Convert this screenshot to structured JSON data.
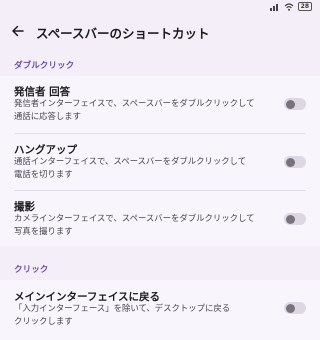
{
  "status": {
    "battery": "28"
  },
  "app_bar": {
    "title": "スペースバーのショートカット"
  },
  "sections": [
    {
      "header": "ダブルクリック",
      "items": [
        {
          "title": "発信者 回答",
          "desc_line1": "発信者インターフェイスで、スペースバーをダブルクリックして",
          "desc_line2": "通話に応答します",
          "enabled": false
        },
        {
          "title": "ハングアップ",
          "desc_line1": "通話インターフェイスで、スペースバーをダブルクリックして",
          "desc_line2": "電話を切ります",
          "enabled": false
        },
        {
          "title": "撮影",
          "desc_line1": "カメラインターフェイスで、スペースバーをダブルクリックして",
          "desc_line2": "写真を撮ります",
          "enabled": false
        }
      ]
    },
    {
      "header": "クリック",
      "items": [
        {
          "title": "メインインターフェイスに戻る",
          "desc_line1": "「入力インターフェース」を除いて、デスクトップに戻る",
          "desc_line2": "クリックします",
          "enabled": false
        }
      ]
    }
  ],
  "icons": {
    "back": "arrow-back-icon",
    "wifi": "wifi-icon",
    "signal": "signal-icon",
    "battery": "battery-icon"
  }
}
